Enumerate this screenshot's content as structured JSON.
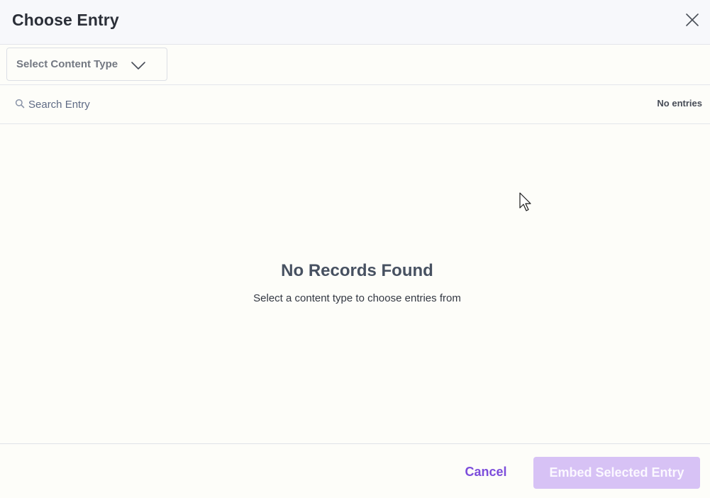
{
  "modal": {
    "title": "Choose Entry"
  },
  "filter": {
    "content_type_placeholder": "Select Content Type"
  },
  "search": {
    "placeholder": "Search Entry",
    "value": "",
    "count_text": "No entries"
  },
  "empty_state": {
    "title": "No Records Found",
    "subtitle": "Select a content type to choose entries from"
  },
  "footer": {
    "cancel_label": "Cancel",
    "embed_label": "Embed Selected Entry"
  },
  "icons": {
    "close": "close-icon",
    "chevron": "chevron-down-icon",
    "search": "search-icon",
    "cursor": "mouse-pointer-icon"
  },
  "colors": {
    "accent": "#7c4ddb",
    "accent_disabled": "#d7c2f5",
    "heading": "#475161",
    "header_bg": "#f7f8fb",
    "page_bg": "#fdfdf9"
  }
}
